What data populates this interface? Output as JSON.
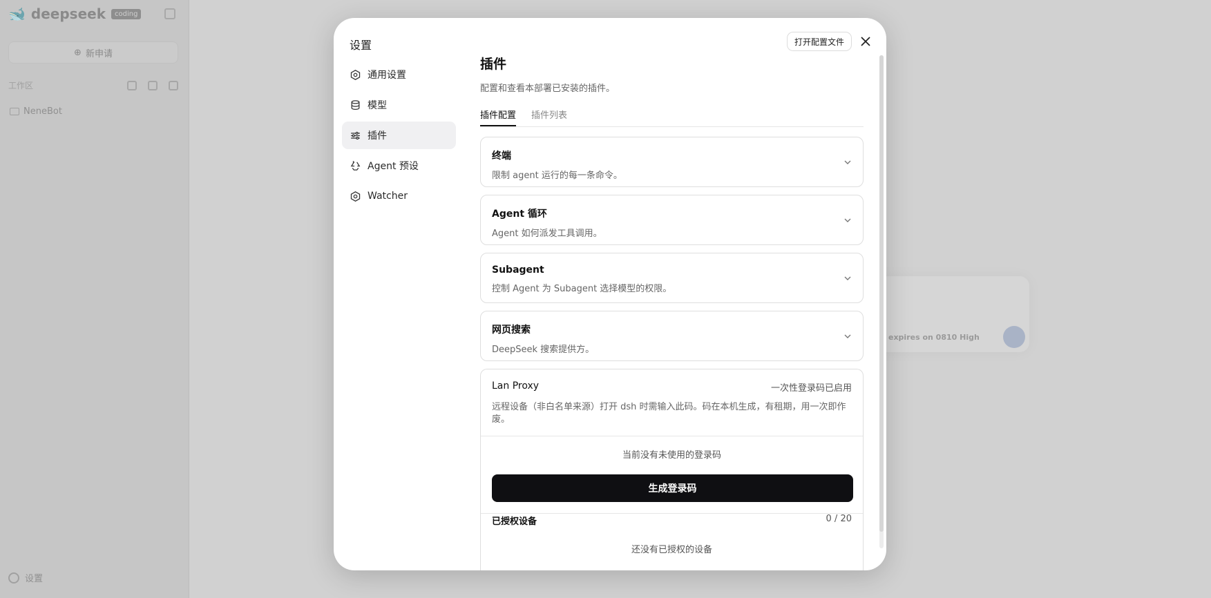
{
  "background": {
    "logo_text": "deepseek",
    "logo_badge": "coding",
    "new_chat": "新申请",
    "workspace_label": "工作区",
    "folder_name": "NeneBot",
    "settings_label": "设置",
    "composer_hint": "expires on 0810 High"
  },
  "modal": {
    "title": "设置",
    "open_config_label": "打开配置文件",
    "nav": [
      {
        "label": "通用设置",
        "icon": "gear-icon"
      },
      {
        "label": "模型",
        "icon": "database-icon"
      },
      {
        "label": "插件",
        "icon": "sliders-icon"
      },
      {
        "label": "Agent 预设",
        "icon": "recycle-icon"
      },
      {
        "label": "Watcher",
        "icon": "gear-icon"
      }
    ],
    "active_nav": "插件"
  },
  "plugins": {
    "title": "插件",
    "subtitle": "配置和查看本部署已安装的插件。",
    "tabs": [
      "插件配置",
      "插件列表"
    ],
    "cards": [
      {
        "title": "终端",
        "desc": "限制 agent 运行的每一条命令。"
      },
      {
        "title": "Agent 循环",
        "desc": "Agent 如何派发工具调用。"
      },
      {
        "title": "Subagent",
        "desc": "控制 Agent 为 Subagent 选择模型的权限。"
      },
      {
        "title": "网页搜索",
        "desc": "DeepSeek 搜索提供方。"
      }
    ],
    "lan_proxy": {
      "title": "Lan Proxy",
      "status": "一次性登录码已启用",
      "desc": "远程设备（非白名单来源）打开 dsh 时需输入此码。码在本机生成，有租期，用一次即作废。",
      "no_code": "当前没有未使用的登录码",
      "generate_label": "生成登录码",
      "devices_title": "已授权设备",
      "devices_count": "0 / 20",
      "no_devices": "还没有已授权的设备"
    }
  }
}
